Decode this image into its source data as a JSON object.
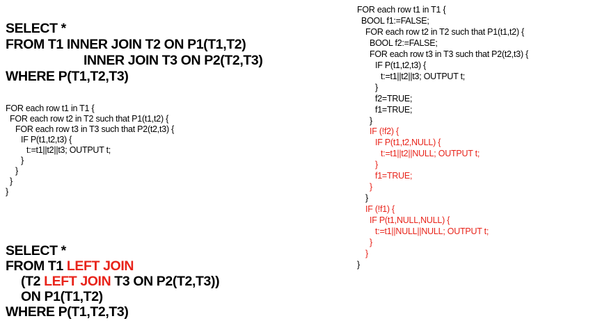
{
  "colors": {
    "text": "#000000",
    "highlight": "#e8231a",
    "background": "#ffffff"
  },
  "query1": {
    "lines": [
      [
        {
          "text": "SELECT *"
        }
      ],
      [
        {
          "text": "FROM T1 INNER JOIN T2 ON P1(T1,T2)"
        }
      ],
      [
        {
          "text": "INNER JOIN T3 ON P2(T2,T3)"
        }
      ],
      [
        {
          "text": "WHERE P(T1,T2,T3)"
        }
      ]
    ]
  },
  "code1": {
    "lines": [
      [
        {
          "text": "FOR each row t1 in T1 {"
        }
      ],
      [
        {
          "text": "FOR each row t2 in T2 such that P1(t1,t2) {"
        }
      ],
      [
        {
          "text": "FOR each row t3 in T3 such that P2(t2,t3) {"
        }
      ],
      [
        {
          "text": "IF P(t1,t2,t3) {"
        }
      ],
      [
        {
          "text": "t:=t1||t2||t3; OUTPUT t;"
        }
      ],
      [
        {
          "text": "}"
        }
      ],
      [
        {
          "text": "}"
        }
      ],
      [
        {
          "text": "}"
        }
      ],
      [
        {
          "text": "}"
        }
      ]
    ]
  },
  "query2": {
    "lines": [
      [
        {
          "text": "SELECT *"
        }
      ],
      [
        {
          "text": "FROM T1 "
        },
        {
          "text": "LEFT JOIN",
          "red": true
        }
      ],
      [
        {
          "text": "(T2 "
        },
        {
          "text": "LEFT JOIN",
          "red": true
        },
        {
          "text": " T3 ON P2(T2,T3))"
        }
      ],
      [
        {
          "text": "ON P1(T1,T2)"
        }
      ],
      [
        {
          "text": "WHERE P(T1,T2,T3)"
        }
      ]
    ]
  },
  "code2": {
    "lines": [
      [
        {
          "text": "FOR each row t1 in T1 {"
        }
      ],
      [
        {
          "text": "BOOL f1:=FALSE;"
        }
      ],
      [
        {
          "text": "FOR each row t2 in T2 such that P1(t1,t2) {"
        }
      ],
      [
        {
          "text": "BOOL f2:=FALSE;"
        }
      ],
      [
        {
          "text": "FOR each row t3 in T3 such that P2(t2,t3) {"
        }
      ],
      [
        {
          "text": "IF P(t1,t2,t3) {"
        }
      ],
      [
        {
          "text": "t:=t1||t2||t3; OUTPUT t;"
        }
      ],
      [
        {
          "text": "}"
        }
      ],
      [
        {
          "text": "f2=TRUE;"
        }
      ],
      [
        {
          "text": "f1=TRUE;"
        }
      ],
      [
        {
          "text": "}"
        }
      ],
      [
        {
          "text": "IF (!f2) {",
          "red": true
        }
      ],
      [
        {
          "text": "IF P(t1,t2,NULL) {",
          "red": true
        }
      ],
      [
        {
          "text": "t:=t1||t2||NULL; OUTPUT t;",
          "red": true
        }
      ],
      [
        {
          "text": "}",
          "red": true
        }
      ],
      [
        {
          "text": "f1=TRUE;",
          "red": true
        }
      ],
      [
        {
          "text": "}",
          "red": true
        }
      ],
      [
        {
          "text": "}"
        }
      ],
      [
        {
          "text": "IF (!f1) {",
          "red": true
        }
      ],
      [
        {
          "text": "IF P(t1,NULL,NULL) {",
          "red": true
        }
      ],
      [
        {
          "text": "t:=t1||NULL||NULL; OUTPUT t;",
          "red": true
        }
      ],
      [
        {
          "text": "}",
          "red": true
        }
      ],
      [
        {
          "text": "}",
          "red": true
        }
      ],
      [
        {
          "text": "}"
        }
      ]
    ]
  }
}
